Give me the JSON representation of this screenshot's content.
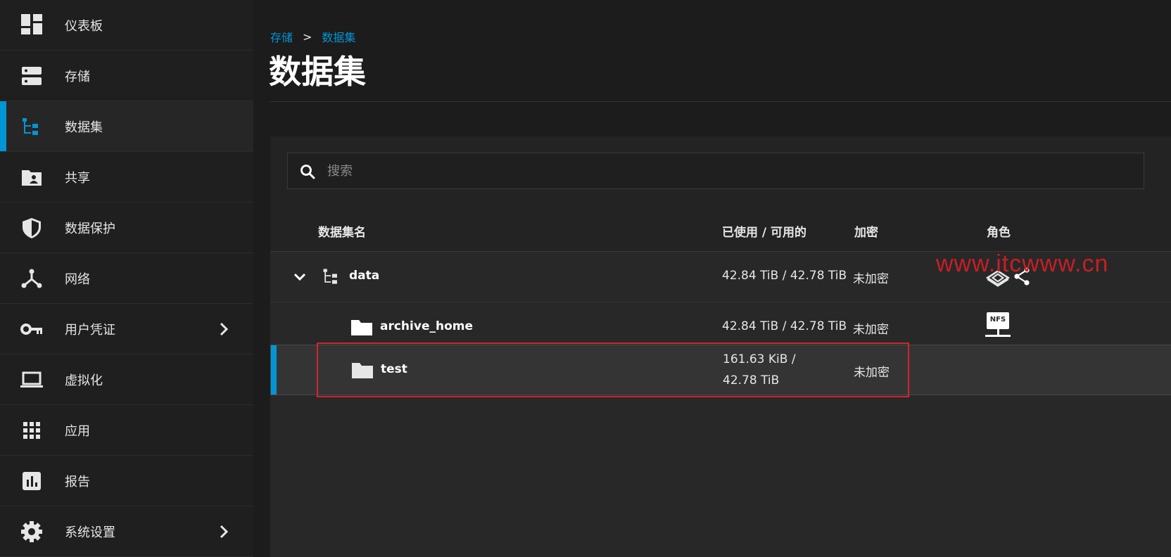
{
  "sidebar": {
    "items": [
      {
        "label": "仪表板",
        "icon": "dashboard-icon"
      },
      {
        "label": "存储",
        "icon": "storage-icon"
      },
      {
        "label": "数据集",
        "icon": "dataset-tree-icon",
        "active": true
      },
      {
        "label": "共享",
        "icon": "share-folder-icon"
      },
      {
        "label": "数据保护",
        "icon": "shield-icon"
      },
      {
        "label": "网络",
        "icon": "network-icon"
      },
      {
        "label": "用户凭证",
        "icon": "key-icon",
        "has_submenu": true
      },
      {
        "label": "虚拟化",
        "icon": "laptop-icon"
      },
      {
        "label": "应用",
        "icon": "apps-grid-icon"
      },
      {
        "label": "报告",
        "icon": "report-chart-icon"
      },
      {
        "label": "系统设置",
        "icon": "gear-icon",
        "has_submenu": true
      }
    ]
  },
  "breadcrumb": {
    "first": "存储",
    "separator": ">",
    "second": "数据集"
  },
  "page": {
    "title": "数据集"
  },
  "search": {
    "placeholder": "搜索"
  },
  "table": {
    "headers": {
      "name": "数据集名",
      "usage": "已使用 / 可用的",
      "encryption": "加密",
      "roles": "角色"
    },
    "rows": [
      {
        "name": "data",
        "usage": "42.84 TiB / 42.78 TiB",
        "encryption": "未加密",
        "expanded": true,
        "roles": [
          "smb-share-icon",
          "share-icon"
        ]
      },
      {
        "name": "archive_home",
        "usage": "42.84 TiB / 42.78 TiB",
        "encryption": "未加密",
        "roles": [
          "nfs-share-icon"
        ]
      },
      {
        "name": "test",
        "usage_line1": "161.63 KiB /",
        "usage_line2": "42.78 TiB",
        "encryption": "未加密",
        "selected": true,
        "roles": []
      }
    ],
    "nfs_label": "NFS"
  },
  "watermark": {
    "text": "www.itcwww.cn"
  },
  "colors": {
    "accent": "#0095d5",
    "highlight": "#d0262d",
    "background": "#1c1c1c"
  }
}
